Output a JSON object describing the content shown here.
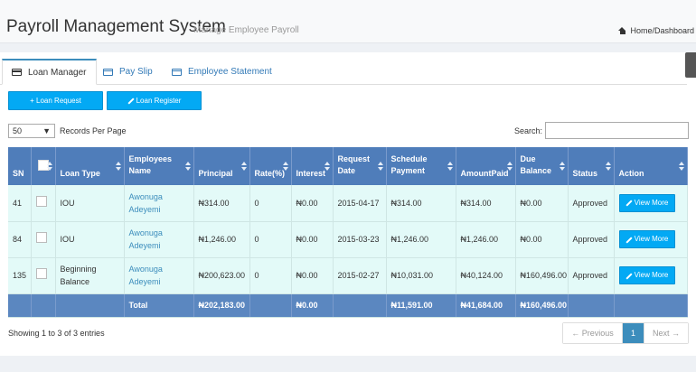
{
  "header": {
    "title": "Payroll Management System",
    "subtitle": "Manage Employee Payroll",
    "breadcrumb": "Home/Dashboard"
  },
  "tabs": [
    {
      "label": "Loan Manager",
      "icon": "card-icon"
    },
    {
      "label": "Pay Slip",
      "icon": "card-icon"
    },
    {
      "label": "Employee Statement",
      "icon": "card-icon"
    }
  ],
  "actions": {
    "loan_request": "+ Loan Request",
    "loan_register": "Loan Register"
  },
  "records": {
    "value": "50",
    "label": "Records Per Page"
  },
  "search": {
    "label": "Search:",
    "value": ""
  },
  "table": {
    "columns": [
      "SN",
      "",
      "Loan Type",
      "Employees Name",
      "Principal",
      "Rate(%)",
      "Interest",
      "Request Date",
      "Schedule Payment",
      "AmountPaid",
      "Due Balance",
      "Status",
      "Action"
    ],
    "rows": [
      {
        "sn": "41",
        "loan_type": "IOU",
        "name": "Awonuga Adeyemi",
        "principal": "₦314.00",
        "rate": "0",
        "interest": "₦0.00",
        "request_date": "2015-04-17",
        "schedule": "₦314.00",
        "amount_paid": "₦314.00",
        "due": "₦0.00",
        "status": "Approved",
        "action": "View More"
      },
      {
        "sn": "84",
        "loan_type": "IOU",
        "name": "Awonuga Adeyemi",
        "principal": "₦1,246.00",
        "rate": "0",
        "interest": "₦0.00",
        "request_date": "2015-03-23",
        "schedule": "₦1,246.00",
        "amount_paid": "₦1,246.00",
        "due": "₦0.00",
        "status": "Approved",
        "action": "View More"
      },
      {
        "sn": "135",
        "loan_type": "Beginning Balance",
        "name": "Awonuga Adeyemi",
        "principal": "₦200,623.00",
        "rate": "0",
        "interest": "₦0.00",
        "request_date": "2015-02-27",
        "schedule": "₦10,031.00",
        "amount_paid": "₦40,124.00",
        "due": "₦160,496.00",
        "status": "Approved",
        "action": "View More"
      }
    ],
    "footer": {
      "label": "Total",
      "principal": "₦202,183.00",
      "interest": "₦0.00",
      "schedule": "₦11,591.00",
      "amount_paid": "₦41,684.00",
      "due": "₦160,496.00"
    }
  },
  "info": "Showing 1 to 3 of 3 entries",
  "pagination": {
    "previous": "← Previous",
    "current": "1",
    "next": "Next →"
  },
  "colors": {
    "accent": "#03a9f4",
    "table_header": "#4f7dba",
    "row_bg": "#e3faf8",
    "link": "#3c8dbc"
  }
}
